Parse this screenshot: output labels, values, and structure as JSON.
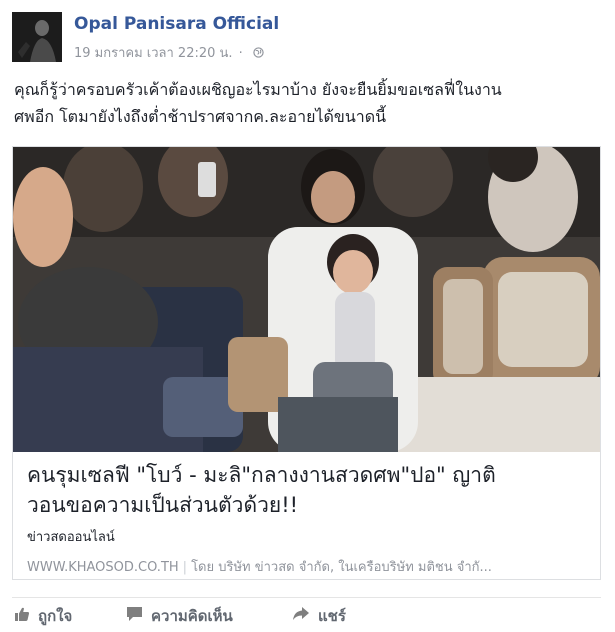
{
  "post": {
    "author": "Opal Panisara Official",
    "timestamp": "19 มกราคม เวลา 22:20 น.",
    "meta_separator": "·",
    "privacy_icon": "globe-icon",
    "text_line_1": "คุณก็รู้ว่าครอบครัวเค้าต้องเผชิญอะไรมาบ้าง ยังจะยืนยิ้มขอเซลฟี่ในงาน",
    "text_line_2": "ศพอีก โตมายังไงถึงต่ำช้าปราศจากค.ละอายได้ขนาดนี้"
  },
  "link": {
    "title_line_1": "คนรุมเซลฟี \"โบว์ - มะลิ\"กลางงานสวดศพ\"ปอ\" ญาติ",
    "title_line_2": "วอนขอความเป็นส่วนตัวด้วย!!",
    "source": "ข่าวสดออนไลน์",
    "domain": "WWW.KHAOSOD.CO.TH",
    "domain_separator": "|",
    "byline": "โดย บริษัท ข่าวสด จำกัด, ในเครือบริษัท มติชน จำกั..."
  },
  "actions": {
    "like": "ถูกใจ",
    "comment": "ความคิดเห็น",
    "share": "แชร์"
  },
  "colors": {
    "author_link": "#365899",
    "meta_gray": "#90949c",
    "action_gray": "#616770",
    "border": "#dddfe2"
  }
}
